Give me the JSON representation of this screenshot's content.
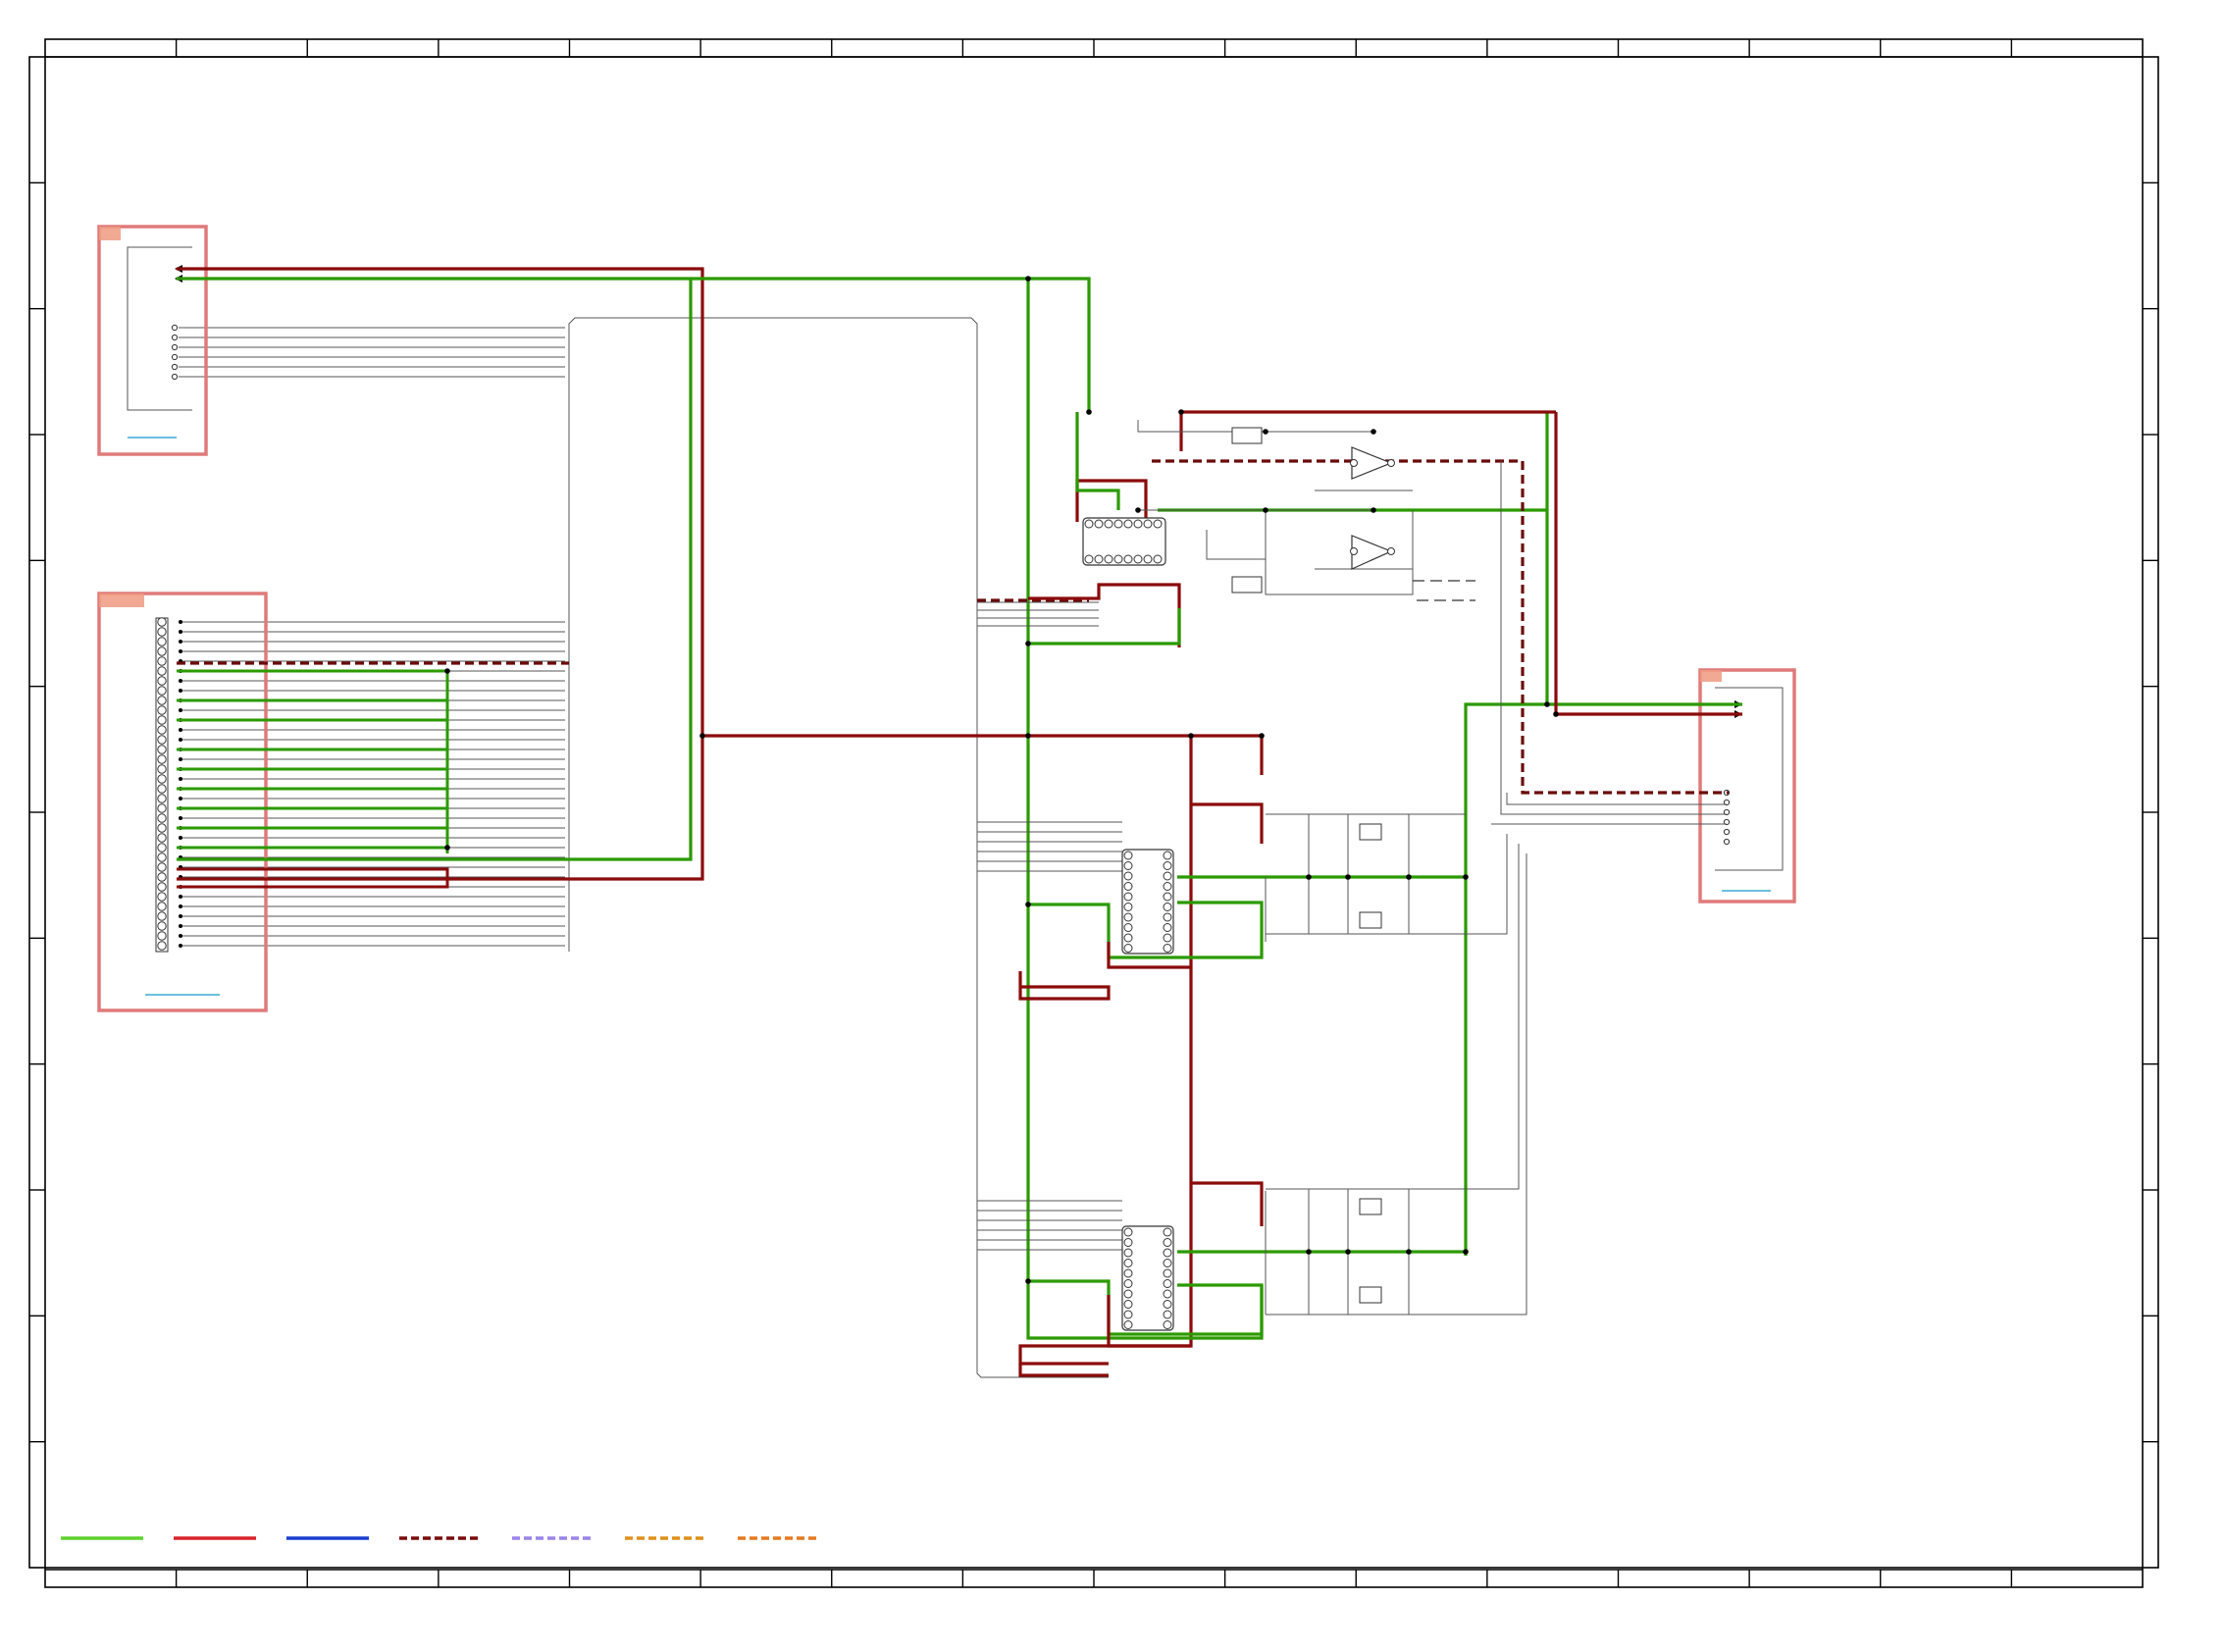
{
  "colors": {
    "green_net": "#2b9a00",
    "red_net": "#8b0b0b",
    "dashed_net": "#6b0a0a",
    "connector_box": "#e07a7a",
    "connector_tab": "#ee9a80",
    "ref_link": "#3aa8d8",
    "frame": "#000000"
  },
  "legend": [
    {
      "name": "legend-line-green",
      "color": "#5ed22f",
      "style": "solid"
    },
    {
      "name": "legend-line-red",
      "color": "#d9232a",
      "style": "solid"
    },
    {
      "name": "legend-line-blue",
      "color": "#1a3fcf",
      "style": "solid"
    },
    {
      "name": "legend-line-darkred-dashed",
      "color": "#7a0c0c",
      "style": "dashed"
    },
    {
      "name": "legend-line-lavender-dashed",
      "color": "#9a84e8",
      "style": "dashed"
    },
    {
      "name": "legend-line-amber-dashed",
      "color": "#e0901a",
      "style": "dashed"
    },
    {
      "name": "legend-line-orange-dashed",
      "color": "#e57a22",
      "style": "dashed"
    }
  ]
}
